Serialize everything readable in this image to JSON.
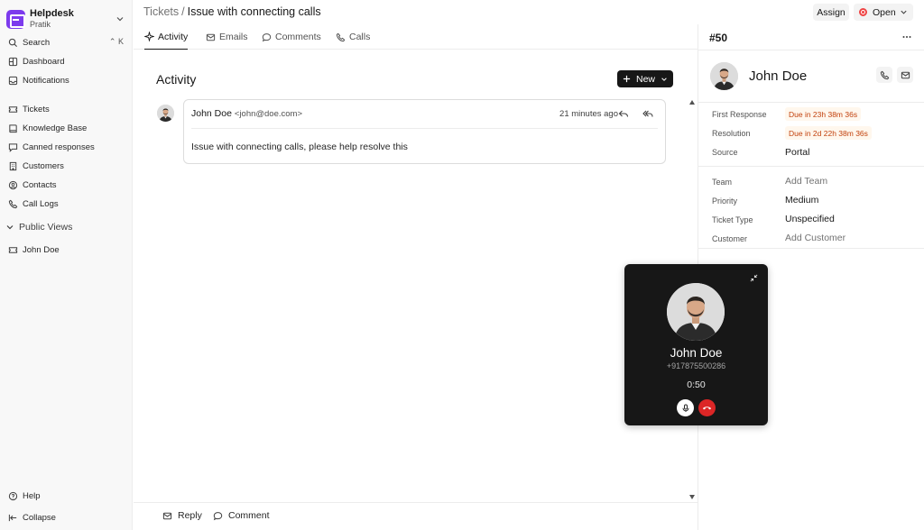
{
  "sidebar": {
    "brand": {
      "title": "Helpdesk",
      "subtitle": "Pratik",
      "accent": "#7c3aed"
    },
    "search": {
      "label": "Search",
      "shortcut": "K"
    },
    "items_top": [
      {
        "label": "Dashboard",
        "icon": "dashboard-icon"
      },
      {
        "label": "Notifications",
        "icon": "bell-icon"
      }
    ],
    "items_main": [
      {
        "label": "Tickets",
        "icon": "ticket-icon"
      },
      {
        "label": "Knowledge Base",
        "icon": "book-icon"
      },
      {
        "label": "Canned responses",
        "icon": "message-icon"
      },
      {
        "label": "Customers",
        "icon": "building-icon"
      },
      {
        "label": "Contacts",
        "icon": "user-icon"
      },
      {
        "label": "Call Logs",
        "icon": "phone-icon"
      }
    ],
    "section_label": "Public Views",
    "views": [
      {
        "label": "John Doe",
        "icon": "view-icon"
      }
    ],
    "footer": {
      "help": "Help",
      "collapse": "Collapse"
    }
  },
  "header": {
    "breadcrumb_root": "Tickets",
    "breadcrumb_sep": "/",
    "breadcrumb_current": "Issue with connecting calls",
    "assign_label": "Assign",
    "status_label": "Open",
    "status_color": "#ef4444"
  },
  "tabs": [
    {
      "label": "Activity",
      "icon": "activity-icon",
      "active": true
    },
    {
      "label": "Emails",
      "icon": "mail-icon",
      "active": false
    },
    {
      "label": "Comments",
      "icon": "comment-icon",
      "active": false
    },
    {
      "label": "Calls",
      "icon": "phone-icon",
      "active": false
    }
  ],
  "activity": {
    "title": "Activity",
    "new_label": "New",
    "message": {
      "author": "John Doe",
      "email": "<john@doe.com>",
      "time": "21 minutes ago",
      "body": "Issue with connecting calls, please help resolve this"
    }
  },
  "composer": {
    "reply_label": "Reply",
    "comment_label": "Comment"
  },
  "ticket": {
    "number": "#50",
    "customer_name": "John Doe",
    "sla": [
      {
        "label": "First Response",
        "value": "Due in 23h 38m 36s"
      },
      {
        "label": "Resolution",
        "value": "Due in 2d 22h 38m 36s"
      }
    ],
    "source": {
      "label": "Source",
      "value": "Portal"
    },
    "fields": [
      {
        "label": "Team",
        "value": "Add Team",
        "placeholder": true
      },
      {
        "label": "Priority",
        "value": "Medium",
        "placeholder": false
      },
      {
        "label": "Ticket Type",
        "value": "Unspecified",
        "placeholder": false
      },
      {
        "label": "Customer",
        "value": "Add Customer",
        "placeholder": true
      }
    ]
  },
  "call": {
    "name": "John Doe",
    "number": "+917875500286",
    "timer": "0:50",
    "hangup_color": "#dc2626"
  }
}
